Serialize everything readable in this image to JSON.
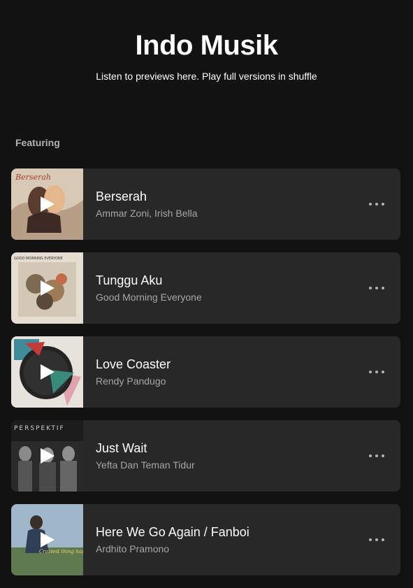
{
  "header": {
    "title": "Indo Musik",
    "subtitle": "Listen to previews here. Play full versions in shuffle"
  },
  "section": {
    "label": "Featuring"
  },
  "tracks": [
    {
      "title": "Berserah",
      "artist": "Ammar Zoni, Irish Bella",
      "cover_text": "Berserah"
    },
    {
      "title": "Tunggu Aku",
      "artist": "Good Morning Everyone",
      "cover_text": "GOOD MORNING EVERYONE"
    },
    {
      "title": "Love Coaster",
      "artist": "Rendy Pandugo"
    },
    {
      "title": "Just Wait",
      "artist": "Yefta Dan Teman Tidur",
      "cover_text": "PERSPEKTIF"
    },
    {
      "title": "Here We Go Again / Fanboi",
      "artist": "Ardhito Pramono",
      "cover_text": "Craziest thing happened in my backyard"
    }
  ],
  "icons": {
    "play": "play-icon",
    "more": "more-options-icon"
  },
  "colors": {
    "background": "#121212",
    "card": "#282828",
    "secondary_text": "#a7a7a7"
  }
}
